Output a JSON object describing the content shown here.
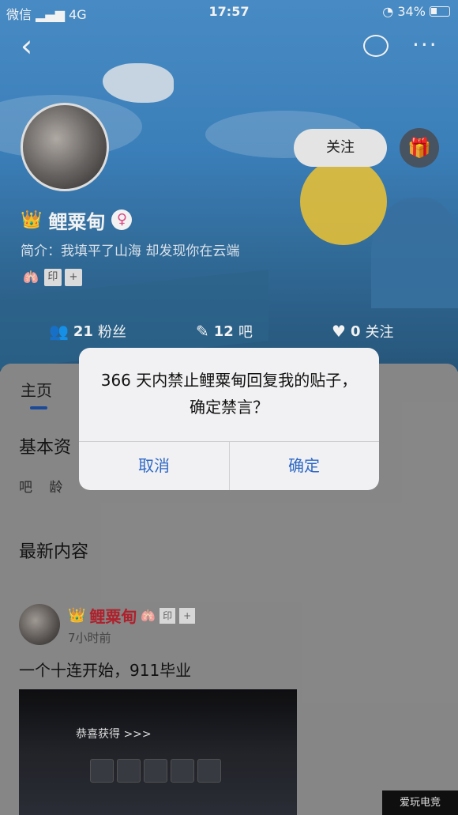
{
  "status_bar": {
    "carrier": "微信",
    "network": "4G",
    "time": "17:57",
    "battery": "34%"
  },
  "profile": {
    "username": "鲤粟甸",
    "bio": "简介：我填平了山海 却发现你在云端",
    "follow_label": "关注",
    "badges": [
      "印",
      "+"
    ]
  },
  "stats": [
    {
      "value": "21",
      "label": "粉丝"
    },
    {
      "value": "12",
      "label": "吧"
    },
    {
      "value": "0",
      "label": "关注"
    }
  ],
  "tabs": {
    "home": "主页"
  },
  "sections": {
    "basic": "基本资",
    "age_label": "吧 龄",
    "latest": "最新内容"
  },
  "post": {
    "author": "鲤粟甸",
    "time": "7小时前",
    "text": "一个十连开始，911毕业",
    "image_banner": "恭喜获得 >>>"
  },
  "dialog": {
    "message": "366 天内禁止鲤粟甸回复我的贴子，确定禁言？",
    "cancel_label": "取消",
    "confirm_label": "确定"
  },
  "colors": {
    "accent": "#2e68c7",
    "username_red": "#b8232f",
    "hero_blue": "#4c93cf"
  }
}
